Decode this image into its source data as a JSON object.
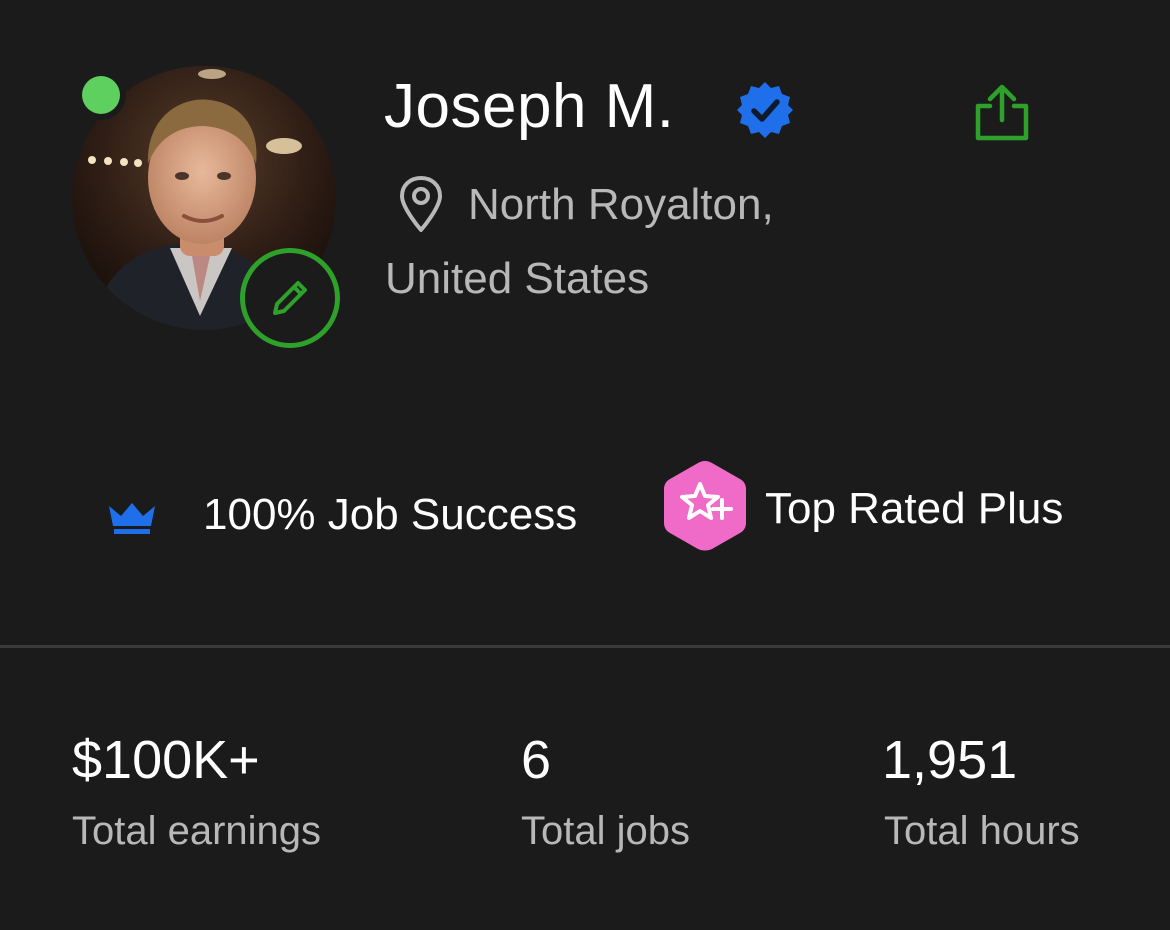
{
  "profile": {
    "name": "Joseph M.",
    "location_line1": "North Royalton,",
    "location_line2": "United States",
    "online_color": "#5ed05f",
    "verified_color": "#1f6feb",
    "accent_green": "#2ea12a"
  },
  "icons": {
    "share": "share-icon",
    "verified": "verified-badge-icon",
    "location": "location-pin-icon",
    "edit": "pencil-icon",
    "job_success": "crown-icon",
    "top_rated": "top-rated-plus-icon"
  },
  "badges": {
    "job_success": "100% Job Success",
    "top_rated": "Top Rated Plus",
    "top_rated_color": "#f06bc7"
  },
  "stats": [
    {
      "value": "$100K+",
      "label": "Total earnings"
    },
    {
      "value": "6",
      "label": "Total jobs"
    },
    {
      "value": "1,951",
      "label": "Total hours"
    }
  ]
}
